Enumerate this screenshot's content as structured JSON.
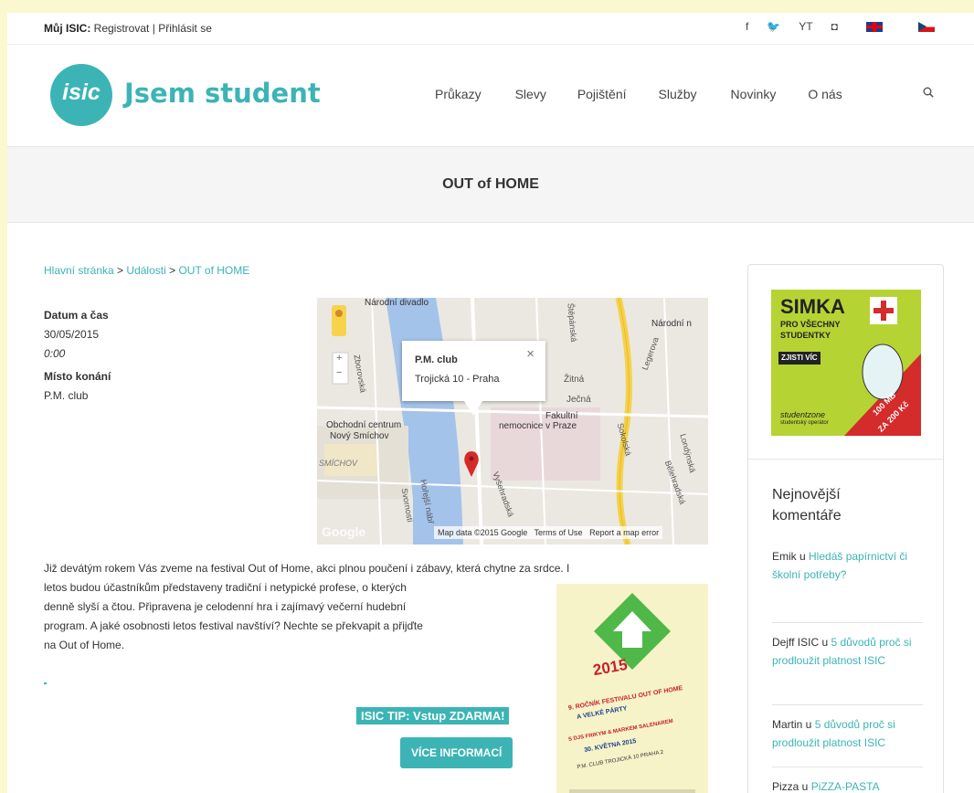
{
  "topbar": {
    "my_isic": "Můj ISIC:",
    "register": "Registrovat",
    "divider": "|",
    "login": "Přihlásit se",
    "social": [
      "f",
      "🐦",
      "YT",
      "◘"
    ]
  },
  "header": {
    "logo_text": "isic",
    "brand": "Jsem student",
    "nav": [
      "Průkazy",
      "Slevy",
      "Pojištění",
      "Služby",
      "Novinky",
      "O nás"
    ]
  },
  "page": {
    "title": "OUT of HOME"
  },
  "breadcrumb": {
    "home": "Hlavní stránka",
    "sep": ">",
    "events": "Události",
    "current": "OUT of HOME"
  },
  "event": {
    "date_label": "Datum a čas",
    "date": "30/05/2015",
    "time": "0:00",
    "place_label": "Místo konání",
    "place": "P.M. club"
  },
  "map": {
    "popup_title": "P.M. club",
    "popup_address": "Trojická 10 - Praha",
    "popup_close": "×",
    "labels": {
      "narodni_divadlo": "Národní divadlo",
      "narodni": "Národní n",
      "zitna": "Žitná",
      "jecna": "Ječná",
      "fakultni": "Fakultní",
      "nemocnice": "nemocnice v Praze",
      "obchodni": "Obchodní centrum",
      "novy_smichov": "Nový Smíchov",
      "smichov": "SMÍCHOV",
      "google": "Google",
      "legerova": "Legerova",
      "sokolska": "Sokolská",
      "zborovska": "Zborovská",
      "stepanska": "Štěpánská",
      "vysehradska": "Vyšehradská",
      "svornosti": "Svornosti",
      "londynska": "Londýnská",
      "belehradska": "Bělehradská",
      "hotelu": "Hořejší nábř"
    },
    "attribution": {
      "data": "Map data ©2015 Google",
      "terms": "Terms of Use",
      "report": "Report a map error"
    },
    "zoom_in": "+",
    "zoom_out": "−"
  },
  "body": {
    "line1": "Již devátým rokem Vás zveme na festival Out of Home, akci plnou poučení i zábavy, která chytne za srdce. I",
    "line2": "letos budou účastníkům představeny tradiční i netypické profese, o kterých",
    "line3": "denně slyší a čtou. Připravena je celodenní hra i zajímavý večerní hudební",
    "line4": "program. A jaké osobnosti letos festival navštíví? Nechte se překvapit a přijďte",
    "line5": "na Out of Home."
  },
  "actions": {
    "tip": "ISIC TIP: Vstup ZDARMA!",
    "more": "VÍCE INFORMACÍ"
  },
  "poster": {
    "year": "2015",
    "l1": "9. ROČNÍK FESTIVALU OUT OF HOME",
    "l2": "A VELKÉ PÁRTY",
    "l3": "S DJS FRIKYM & MARKEM SALENAREM",
    "l4": "30. KVĚTNA 2015",
    "l5": "P.M. CLUB TROJICKÁ 10 PRAHA 2"
  },
  "sidebar": {
    "ad": {
      "title": "SIMKA",
      "sub1": "PRO VŠECHNY",
      "sub2": "STUDENTKY",
      "cta": "ZJISTI VÍC",
      "brand": "studentzone",
      "tagline": "studentský operátor",
      "price1": "100 MB",
      "price2": "ZA 200 Kč"
    },
    "heading_line1": "Nejnovější",
    "heading_line2": "komentáře",
    "comments": [
      {
        "author": "Emik",
        "sep": " u ",
        "link": "Hledáš papírnictví či školní potřeby?"
      },
      {
        "author": "Dejff ISIC",
        "sep": " u ",
        "link": "5 důvodů proč si prodloužit platnost ISIC"
      },
      {
        "author": "Martin",
        "sep": " u ",
        "link": "5 důvodů proč si prodloužit platnost ISIC"
      },
      {
        "author": "Pizza",
        "sep": " u ",
        "link": "PiZZA-PASTA"
      }
    ]
  },
  "colors": {
    "accent": "#3cb4b5",
    "page_bg": "#fbf7cf",
    "ad_green": "#b6d334"
  }
}
